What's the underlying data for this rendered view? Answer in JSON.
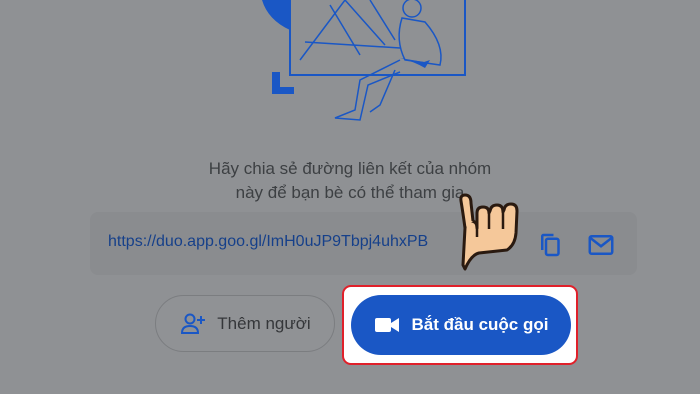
{
  "share": {
    "line1": "Hãy chia sẻ đường liên kết của nhóm",
    "line2": "này để bạn bè có thể tham gia"
  },
  "link": {
    "url": "https://duo.app.goo.gl/ImH0uJP9Tbpj4uhxPB"
  },
  "icons": {
    "copy": "copy-icon",
    "email": "email-icon",
    "add_person": "add-person-icon",
    "video": "video-camera-icon"
  },
  "buttons": {
    "add_people_label": "Thêm người",
    "start_call_label": "Bắt đầu cuộc gọi"
  },
  "colors": {
    "accent": "#1a57c5",
    "highlight": "#e0202a",
    "overlay": "#8f9194"
  }
}
